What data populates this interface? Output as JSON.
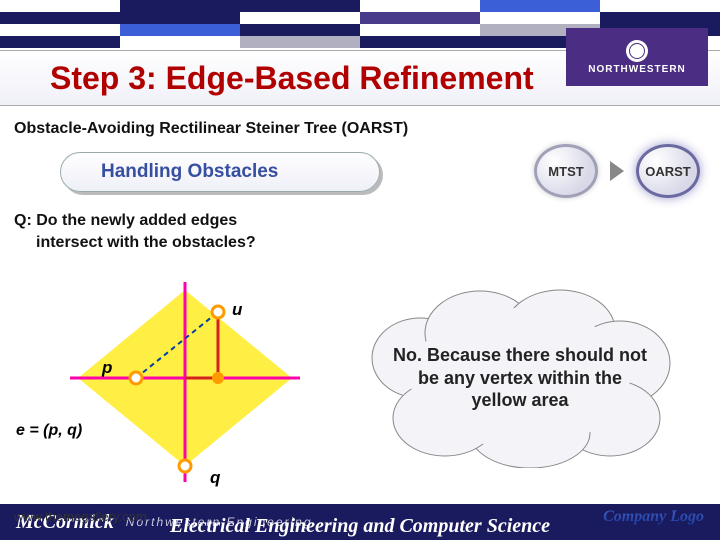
{
  "header": {
    "title": "Step 3: Edge-Based Refinement",
    "subtitle": "Obstacle-Avoiding Rectilinear Steiner Tree (OARST)",
    "section": "Handling Obstacles",
    "logo_line1": "NORTHWESTERN"
  },
  "breadcrumb": {
    "left": "MTST",
    "right": "OARST"
  },
  "question": {
    "line1": "Q: Do the newly added edges",
    "line2": "intersect with the obstacles?"
  },
  "diagram": {
    "u": "u",
    "p": "p",
    "q": "q",
    "e": "e = (p, q)",
    "colors": {
      "region": "#ffee44",
      "edge_main": "#ff00aa",
      "edge_new": "#d62020",
      "node_stroke": "#ff9a00",
      "axis": "#0040a0"
    }
  },
  "answer": "No. Because there should not be any vertex within the yellow area",
  "footer": {
    "url": "www.themegallery.com",
    "mc": "McCormick",
    "nw": "Northwestern Engineering",
    "dept": "Electrical Engineering and Computer Science",
    "company": "Company Logo"
  }
}
